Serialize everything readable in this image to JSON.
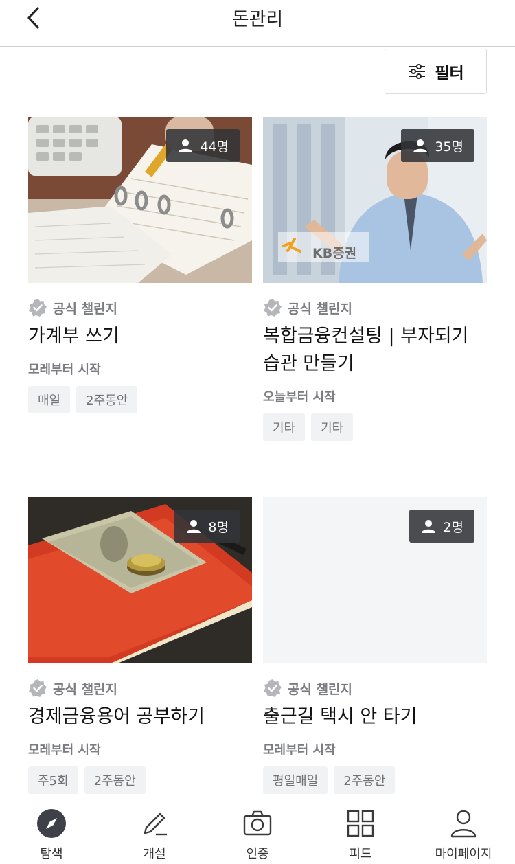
{
  "header": {
    "title": "돈관리"
  },
  "filter": {
    "label": "필터"
  },
  "cards": [
    {
      "count": "44명",
      "official": "공식 챌린지",
      "title": "가계부 쓰기",
      "start": "모레부터 시작",
      "tags": [
        "매일",
        "2주동안"
      ]
    },
    {
      "count": "35명",
      "official": "공식 챌린지",
      "title": "복합금융컨설팅 | 부자되기 습관 만들기",
      "start": "오늘부터 시작",
      "tags": [
        "기타",
        "기타"
      ],
      "logo_text": "KB증권"
    },
    {
      "count": "8명",
      "official": "공식 챌린지",
      "title": "경제금융용어 공부하기",
      "start": "모레부터 시작",
      "tags": [
        "주5회",
        "2주동안"
      ]
    },
    {
      "count": "2명",
      "official": "공식 챌린지",
      "title": "출근길 택시 안 타기",
      "start": "모레부터 시작",
      "tags": [
        "평일매일",
        "2주동안"
      ]
    }
  ],
  "tabbar": {
    "items": [
      {
        "label": "탐색",
        "icon": "compass-icon"
      },
      {
        "label": "개설",
        "icon": "pencil-icon"
      },
      {
        "label": "인증",
        "icon": "camera-icon"
      },
      {
        "label": "피드",
        "icon": "grid-icon"
      },
      {
        "label": "마이페이지",
        "icon": "person-icon"
      }
    ]
  }
}
